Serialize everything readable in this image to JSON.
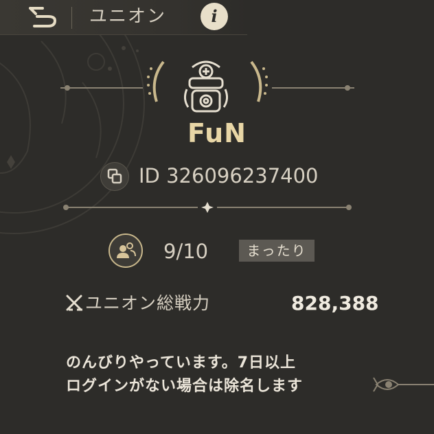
{
  "header": {
    "title": "ユニオン",
    "info_label": "i"
  },
  "union": {
    "name": "FuN",
    "id_text": "ID 326096237400",
    "member_count": "9/10",
    "tag": "まったり",
    "power_label": "ユニオン総戦力",
    "power_value": "828,388",
    "description": [
      "のんびりやっています。7日以上",
      "ログインがない場合は除名します"
    ]
  },
  "icons": {
    "back": "back-arrow-icon",
    "info": "info-icon",
    "emblem": "union-emblem-icon",
    "copy": "copy-icon",
    "members": "members-icon",
    "power": "crossed-swords-icon"
  },
  "colors": {
    "background": "#2d2c29",
    "gold": "#e8d6a6",
    "accent": "#c9b88c",
    "tag_bg": "#5c5953"
  }
}
